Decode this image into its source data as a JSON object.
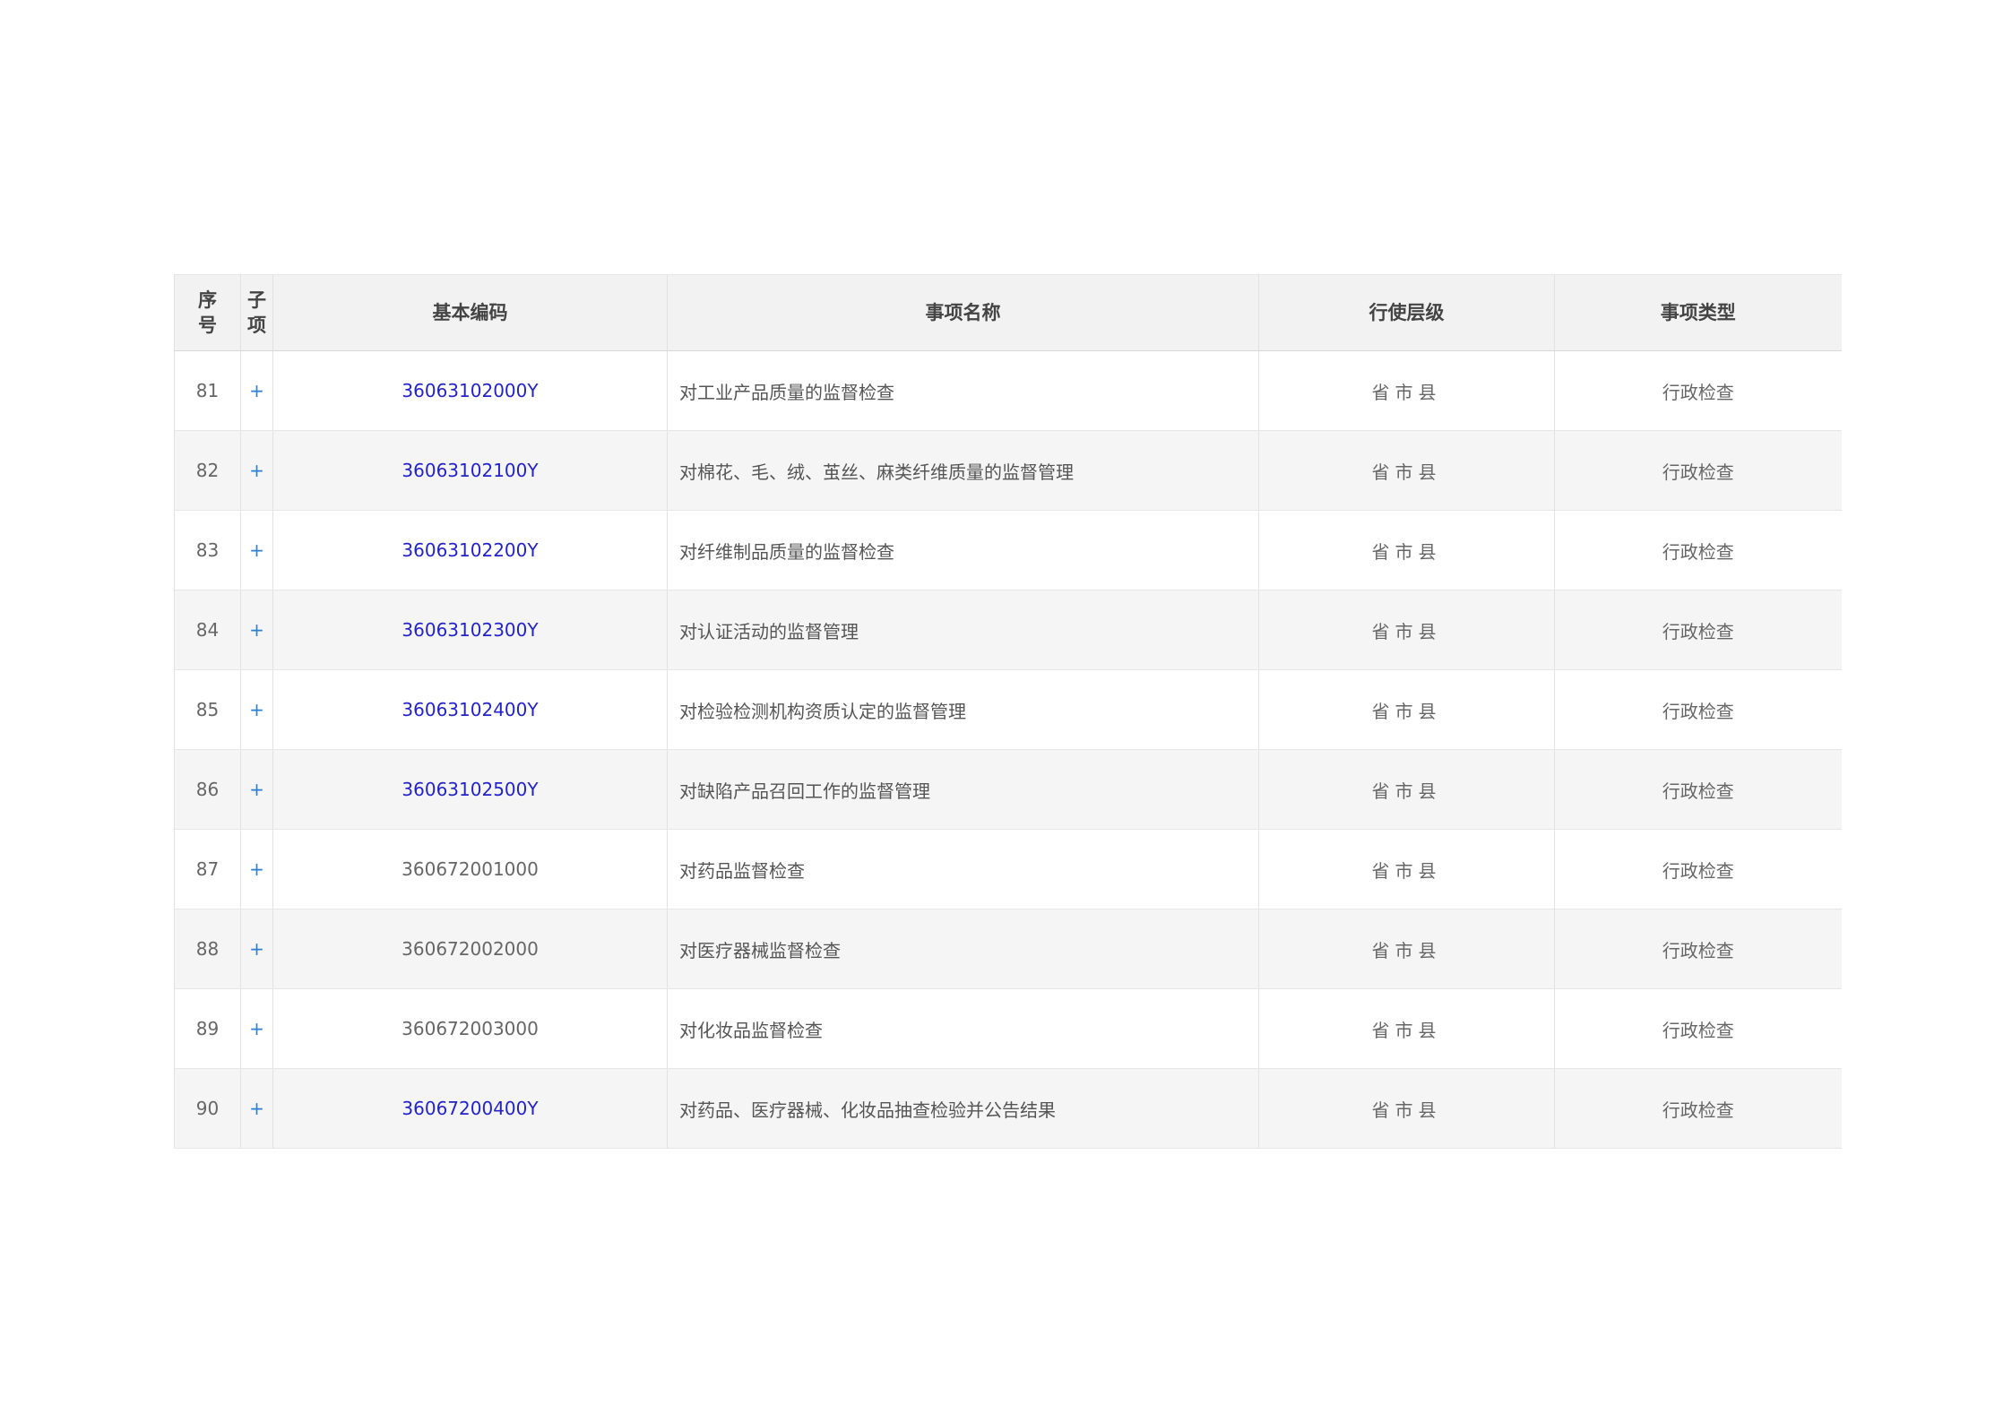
{
  "table": {
    "headers": {
      "seq_line1": "序",
      "seq_line2": "号",
      "sub_line1": "子",
      "sub_line2": "项",
      "code": "基本编码",
      "name": "事项名称",
      "level": "行使层级",
      "type": "事项类型"
    },
    "rows": [
      {
        "seq": "81",
        "sub": "+",
        "code": "36063102000Y",
        "code_is_link": true,
        "name": "对工业产品质量的监督检查",
        "level": "省市县",
        "type": "行政检查"
      },
      {
        "seq": "82",
        "sub": "+",
        "code": "36063102100Y",
        "code_is_link": true,
        "name": "对棉花、毛、绒、茧丝、麻类纤维质量的监督管理",
        "level": "省市县",
        "type": "行政检查"
      },
      {
        "seq": "83",
        "sub": "+",
        "code": "36063102200Y",
        "code_is_link": true,
        "name": "对纤维制品质量的监督检查",
        "level": "省市县",
        "type": "行政检查"
      },
      {
        "seq": "84",
        "sub": "+",
        "code": "36063102300Y",
        "code_is_link": true,
        "name": "对认证活动的监督管理",
        "level": "省市县",
        "type": "行政检查"
      },
      {
        "seq": "85",
        "sub": "+",
        "code": "36063102400Y",
        "code_is_link": true,
        "name": "对检验检测机构资质认定的监督管理",
        "level": "省市县",
        "type": "行政检查"
      },
      {
        "seq": "86",
        "sub": "+",
        "code": "36063102500Y",
        "code_is_link": true,
        "name": "对缺陷产品召回工作的监督管理",
        "level": "省市县",
        "type": "行政检查"
      },
      {
        "seq": "87",
        "sub": "+",
        "code": "360672001000",
        "code_is_link": false,
        "name": "对药品监督检查",
        "level": "省市县",
        "type": "行政检查"
      },
      {
        "seq": "88",
        "sub": "+",
        "code": "360672002000",
        "code_is_link": false,
        "name": "对医疗器械监督检查",
        "level": "省市县",
        "type": "行政检查"
      },
      {
        "seq": "89",
        "sub": "+",
        "code": "360672003000",
        "code_is_link": false,
        "name": "对化妆品监督检查",
        "level": "省市县",
        "type": "行政检查"
      },
      {
        "seq": "90",
        "sub": "+",
        "code": "36067200400Y",
        "code_is_link": true,
        "name": "对药品、医疗器械、化妆品抽查检验并公告结果",
        "level": "省市县",
        "type": "行政检查"
      }
    ]
  },
  "colors": {
    "link": "#2323cc",
    "plus": "#2b7fd4",
    "header_bg": "#f2f2f2",
    "stripe_bg": "#f5f5f5"
  }
}
